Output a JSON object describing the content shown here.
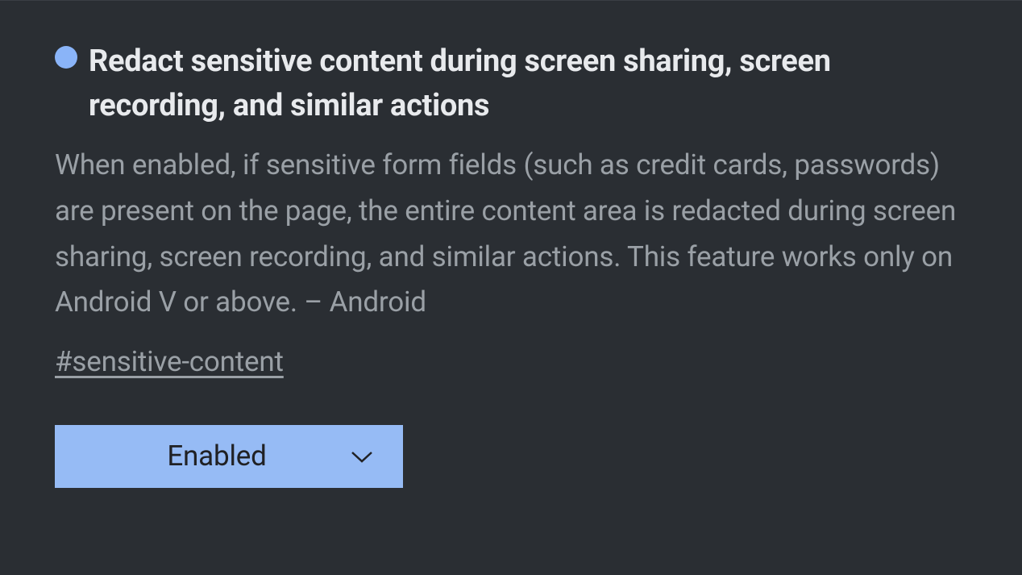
{
  "flag": {
    "title": "Redact sensitive content during screen sharing, screen recording, and similar actions",
    "description": "When enabled, if sensitive form fields (such as credit cards, passwords) are present on the page, the entire content area is redacted during screen sharing, screen recording, and similar actions. This feature works only on Android V or above. – Android",
    "hash": "#sensitive-content",
    "dropdown_value": "Enabled",
    "status": "modified"
  },
  "colors": {
    "status_dot": "#8ab4f8",
    "dropdown_bg": "#96bbf5",
    "bg": "#2a2e33",
    "title_text": "#e8eaed",
    "desc_text": "#9aa0a6"
  }
}
